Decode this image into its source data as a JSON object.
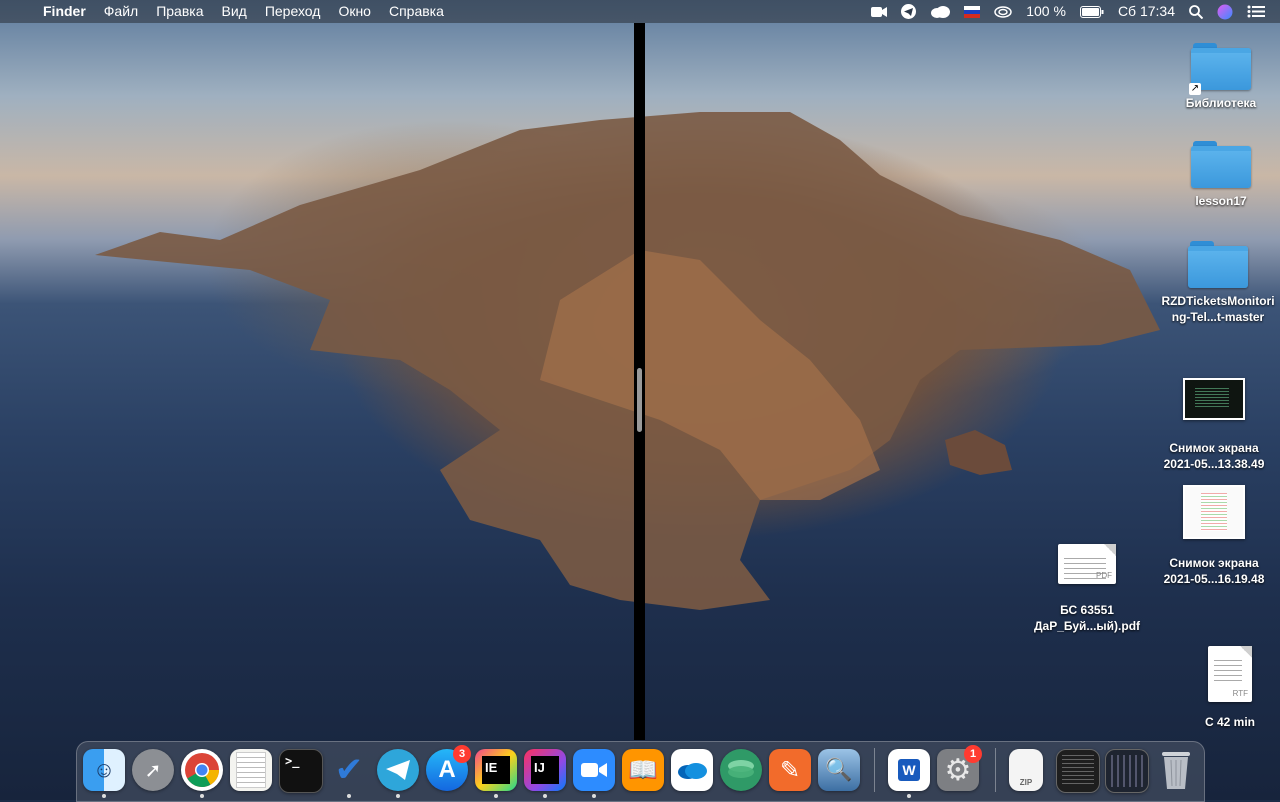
{
  "menubar": {
    "apple_glyph": "",
    "app_name": "Finder",
    "menus": [
      "Файл",
      "Правка",
      "Вид",
      "Переход",
      "Окно",
      "Справка"
    ],
    "status": {
      "battery": "100 %",
      "clock": "Сб 17:34"
    }
  },
  "desktop": {
    "items": [
      {
        "label": "Библиотека",
        "type": "folder-alias"
      },
      {
        "label": "lesson17",
        "type": "folder"
      },
      {
        "label": "RZDTicketsMonitoring-Tel...t-master",
        "type": "folder"
      },
      {
        "label": "Снимок экрана 2021-05...13.38.49",
        "type": "screenshot-dark"
      },
      {
        "label": "Снимок экрана 2021-05...16.19.48",
        "type": "screenshot-light"
      },
      {
        "label": "БС 63551 ДаР_Буй...ый).pdf",
        "type": "pdf",
        "tag": "PDF"
      },
      {
        "label": "С 42 min",
        "type": "rtf",
        "tag": "RTF"
      }
    ]
  },
  "dock": {
    "apps": [
      {
        "name": "Finder",
        "icon": "finder-icon",
        "running": true
      },
      {
        "name": "Launchpad",
        "icon": "rocket-icon",
        "running": false
      },
      {
        "name": "Google Chrome",
        "icon": "chrome-icon",
        "running": true
      },
      {
        "name": "TextEdit",
        "icon": "notepad-icon",
        "running": false
      },
      {
        "name": "Terminal",
        "icon": "terminal-icon",
        "glyph": ">_",
        "running": false
      },
      {
        "name": "Tasks",
        "icon": "checkmark-icon",
        "running": true
      },
      {
        "name": "Telegram",
        "icon": "paper-plane-icon",
        "running": true
      },
      {
        "name": "App Store",
        "icon": "appstore-icon",
        "badge": "3",
        "running": false
      },
      {
        "name": "PyCharm",
        "icon": "ide-icon",
        "glyph": "IE",
        "running": true
      },
      {
        "name": "IntelliJ IDEA",
        "icon": "ide-icon",
        "glyph": "IJ",
        "running": true
      },
      {
        "name": "Zoom",
        "icon": "video-camera-icon",
        "running": true
      },
      {
        "name": "Books",
        "icon": "book-icon",
        "running": false
      },
      {
        "name": "OneDrive",
        "icon": "cloud-icon",
        "running": false
      },
      {
        "name": "Maps",
        "icon": "layers-icon",
        "running": false
      },
      {
        "name": "Sketch",
        "icon": "pen-icon",
        "running": false
      },
      {
        "name": "Preview",
        "icon": "photos-icon",
        "running": false
      },
      {
        "name": "Microsoft Word",
        "icon": "word-icon",
        "glyph": "W",
        "running": true
      },
      {
        "name": "System Preferences",
        "icon": "gear-icon",
        "badge": "1",
        "running": false
      },
      {
        "name": "Archive",
        "icon": "zip-icon",
        "tag": "ZIP",
        "running": false
      },
      {
        "name": "Recent screenshot",
        "icon": "screenshot-icon",
        "running": false
      },
      {
        "name": "Recent screenshot 2",
        "icon": "screenshot-icon",
        "running": false
      },
      {
        "name": "Trash",
        "icon": "trash-icon",
        "running": false
      }
    ]
  }
}
